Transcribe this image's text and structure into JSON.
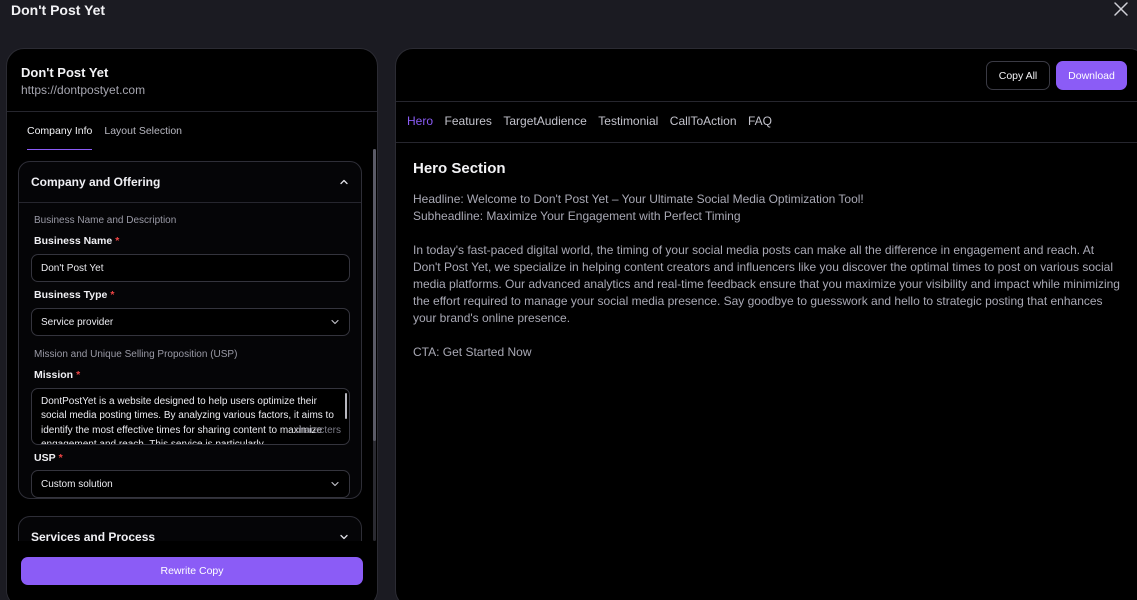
{
  "modal": {
    "title": "Don't Post Yet"
  },
  "company": {
    "name": "Don't Post Yet",
    "url": "https://dontpostyet.com"
  },
  "left_tabs": [
    "Company Info",
    "Layout Selection"
  ],
  "card1": {
    "title": "Company and Offering",
    "section1": "Business Name and Description",
    "business_name_label": "Business Name",
    "business_name_value": "Don't Post Yet",
    "business_type_label": "Business Type",
    "business_type_value": "Service provider",
    "section2": "Mission and Unique Selling Proposition (USP)",
    "mission_label": "Mission",
    "mission_value": "DontPostYet is a website designed to help users optimize their social media posting times. By analyzing various factors, it aims to identify the most effective times for sharing content to maximize engagement and reach. This service is particularly",
    "mission_overlay": "characters",
    "usp_label": "USP",
    "usp_value": "Custom solution",
    "required_mark": "*"
  },
  "card2": {
    "title": "Services and Process"
  },
  "footer": {
    "rewrite_label": "Rewrite Copy"
  },
  "toolbar": {
    "copy_all_label": "Copy All",
    "download_label": "Download"
  },
  "right_tabs": [
    "Hero",
    "Features",
    "TargetAudience",
    "Testimonial",
    "CallToAction",
    "FAQ"
  ],
  "hero": {
    "title": "Hero Section",
    "headline": "Headline: Welcome to Don't Post Yet – Your Ultimate Social Media Optimization Tool!",
    "subheadline": "Subheadline: Maximize Your Engagement with Perfect Timing",
    "body": "In today's fast-paced digital world, the timing of your social media posts can make all the difference in engagement and reach. At Don't Post Yet, we specialize in helping content creators and influencers like you discover the optimal times to post on various social media platforms. Our advanced analytics and real-time feedback ensure that you maximize your visibility and impact while minimizing the effort required to manage your social media presence. Say goodbye to guesswork and hello to strategic posting that enhances your brand's online presence.",
    "cta": "CTA: Get Started Now"
  },
  "colors": {
    "accent": "#8b5cf6",
    "required": "#ef4444",
    "background": "#000000"
  },
  "icons": [
    "close-icon",
    "chevron-up-icon",
    "chevron-down-icon"
  ]
}
